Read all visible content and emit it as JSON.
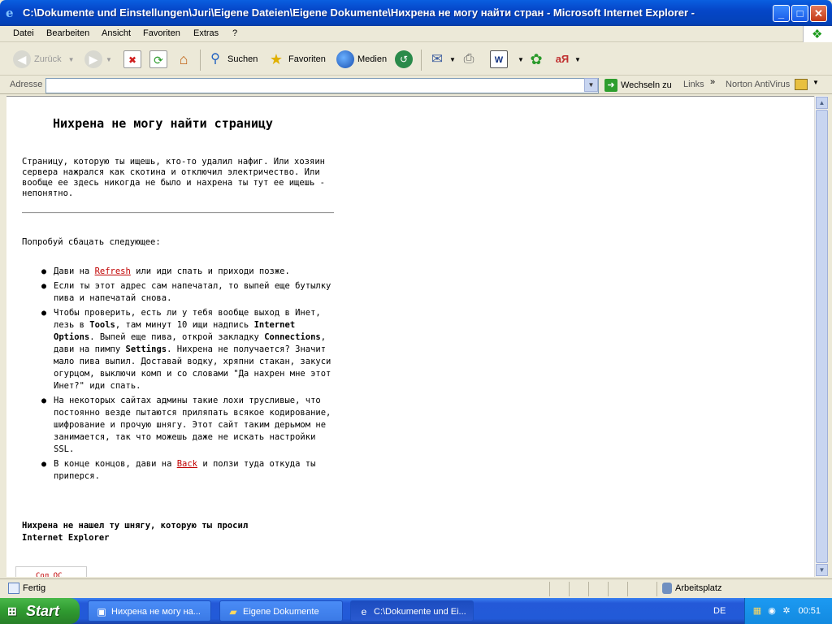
{
  "window": {
    "title": "C:\\Dokumente und Einstellungen\\Juri\\Eigene Dateien\\Eigene Dokumente\\Нихрена не могу найти стран - Microsoft Internet Explorer -",
    "minimize": "_",
    "maximize": "□",
    "close": "✕"
  },
  "menu": [
    "Datei",
    "Bearbeiten",
    "Ansicht",
    "Favoriten",
    "Extras",
    "?"
  ],
  "toolbar": {
    "back": "Zurück",
    "search": "Suchen",
    "favorites": "Favoriten",
    "media": "Medien"
  },
  "address": {
    "label": "Adresse",
    "value": "",
    "go": "Wechseln zu",
    "links": "Links",
    "links_chevron": "»",
    "norton": "Norton AntiVirus"
  },
  "page": {
    "heading": "Нихрена не могу найти страницу",
    "intro": [
      "Страницу, которую ты ищешь, кто-то удалил нафиг. Или хозяин",
      "сервера нажрался как скотина и отключил электричество. Или",
      "вообще ее здесь никогда не было и нахрена ты тут ее ищешь -",
      "непонятно."
    ],
    "try_label": "Попробуй сбацать следующее:",
    "items": [
      {
        "pre": "Дави на   ",
        "link": "Refresh",
        "post": " или иди спать и приходи позже."
      },
      {
        "text": "Если ты этот адрес сам напечатал, то выпей еще бутылку пива и напечатай снова."
      },
      {
        "p1": "Чтобы проверить, есть ли у тебя вообще выход в Инет, лезь в  ",
        "b1": "Tools",
        "p2": ", там минут 10 ищи надпись ",
        "b2": "Internet Options",
        "p3": ". Выпей еще пива, открой закладку ",
        "b3": "Connections",
        "p4": ", дави на пимпу ",
        "b4": "Settings",
        "p5": ". Нихрена не получается? Значит мало пива выпил. Доставай водку, хряпни стакан, закуси огурцом, выключи комп и со словами \"Да нахрен мне этот Инет?\" иди спать."
      },
      {
        "text": "На некоторых сайтах админы такие лохи трусливые, что постоянно везде пытаются приляпать всякое кодирование, шифрование и прочую шнягу. Этот сайт таким дерьмом не занимается, так что можешь даже не искать настройки SSL."
      },
      {
        "pre": "В конце концов, дави на   ",
        "link": "Back",
        "post": " и ползи туда откуда ты приперся."
      }
    ],
    "signature": [
      "Нихрена не нашел ту шнягу, которую ты просил",
      "Internet Explorer"
    ],
    "seal_text": "Сол ОС"
  },
  "status": {
    "text": "Fertig",
    "zone": "Arbeitsplatz"
  },
  "taskbar": {
    "start": "Start",
    "tasks": [
      {
        "label": "Нихрена не могу на..."
      },
      {
        "label": "Eigene Dokumente"
      },
      {
        "label": "C:\\Dokumente und Ei..."
      }
    ],
    "lang": "DE",
    "clock": "00:51"
  }
}
